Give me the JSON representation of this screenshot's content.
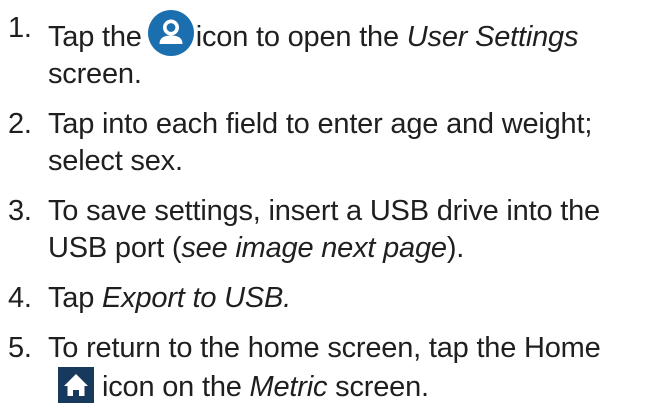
{
  "colors": {
    "text": "#1f1f1f",
    "user_icon_bg": "#1c6fae",
    "home_icon_bg": "#173a5c"
  },
  "icons": {
    "user": "user-icon",
    "home": "home-icon"
  },
  "steps": [
    {
      "number": "1.",
      "text_before": "Tap the",
      "text_middle": "icon to open the",
      "emphasis": "User Settings",
      "text_after": "screen."
    },
    {
      "number": "2.",
      "text": "Tap into each field to enter age and weight; select sex."
    },
    {
      "number": "3.",
      "text_before": "To save settings, insert a USB drive into the USB port (",
      "emphasis": "see image next page",
      "text_after": ")."
    },
    {
      "number": "4.",
      "text_before": "Tap",
      "emphasis": "Export to USB."
    },
    {
      "number": "5.",
      "text_before": "To return to the home screen, tap the Home",
      "text_middle": "icon on the",
      "emphasis": "Metric",
      "text_after": "screen."
    }
  ]
}
